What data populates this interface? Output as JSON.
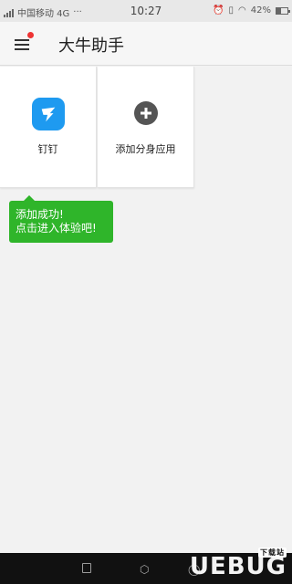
{
  "status_bar": {
    "carrier": "中国移动 4G",
    "more": "···",
    "time": "10:27",
    "battery_percent": "42%",
    "battery_level": 0.42
  },
  "app_bar": {
    "title": "大牛助手",
    "menu_icon": "hamburger-icon",
    "has_notification_dot": true,
    "notification_color": "#e33333"
  },
  "apps": [
    {
      "label": "钉钉",
      "icon": "dingtalk-icon",
      "icon_color": "#1e9af0"
    },
    {
      "label": "添加分身应用",
      "icon": "plus-circle-icon",
      "icon_color": "#555555"
    }
  ],
  "tooltip": {
    "line1": "添加成功!",
    "line2": "点击进入体验吧!",
    "color": "#2fb52a"
  },
  "nav_bar": {
    "back_icon": "square-back-icon",
    "home_icon": "hexagon-home-icon",
    "recent_icon": "circle-recent-icon"
  },
  "watermark": {
    "text": "UEBUG",
    "badge": "下载站"
  }
}
